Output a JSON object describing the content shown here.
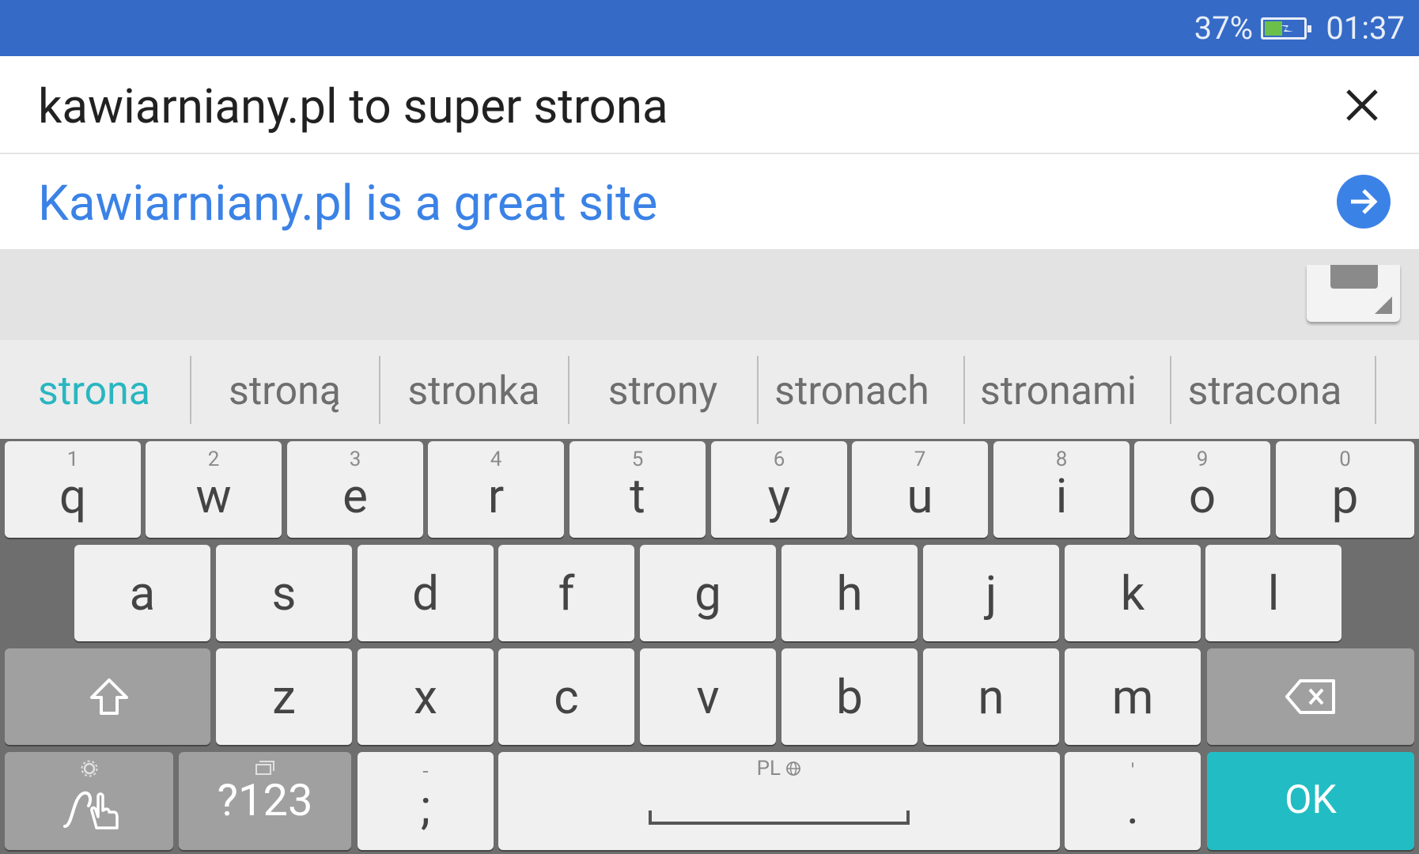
{
  "status_bar": {
    "battery_percent": "37%",
    "time": "01:37"
  },
  "translator": {
    "input_text": "kawiarniany.pl to super strona",
    "translation_text": "Kawiarniany.pl is a great site"
  },
  "suggestions": [
    "strona",
    "stroną",
    "stronka",
    "strony",
    "stronach",
    "stronami",
    "stracona"
  ],
  "keyboard": {
    "row1": [
      {
        "key": "q",
        "sub": "1"
      },
      {
        "key": "w",
        "sub": "2"
      },
      {
        "key": "e",
        "sub": "3"
      },
      {
        "key": "r",
        "sub": "4"
      },
      {
        "key": "t",
        "sub": "5"
      },
      {
        "key": "y",
        "sub": "6"
      },
      {
        "key": "u",
        "sub": "7"
      },
      {
        "key": "i",
        "sub": "8"
      },
      {
        "key": "o",
        "sub": "9"
      },
      {
        "key": "p",
        "sub": "0"
      }
    ],
    "row2": [
      "a",
      "s",
      "d",
      "f",
      "g",
      "h",
      "j",
      "k",
      "l"
    ],
    "row3": [
      "z",
      "x",
      "c",
      "v",
      "b",
      "n",
      "m"
    ],
    "symbols_label": "?123",
    "semicolon_main": ";",
    "semicolon_sub": "-",
    "space_language": "PL",
    "period_main": ".",
    "period_sub": "'",
    "ok_label": "OK"
  },
  "colors": {
    "accent": "#356ac6",
    "translation_blue": "#3b82e6",
    "teal": "#22bdc4"
  }
}
